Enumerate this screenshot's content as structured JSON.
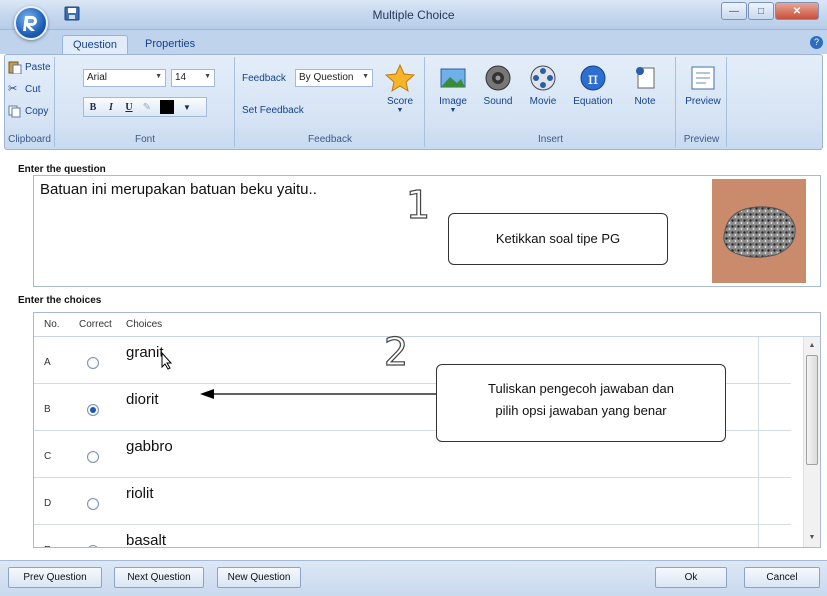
{
  "window": {
    "title": "Multiple Choice"
  },
  "tabs": [
    {
      "label": "Question"
    },
    {
      "label": "Properties"
    }
  ],
  "ribbon": {
    "clipboard": {
      "paste": "Paste",
      "cut": "Cut",
      "copy": "Copy",
      "label": "Clipboard"
    },
    "font": {
      "family": "Arial",
      "size": "14",
      "bold": "B",
      "italic": "I",
      "underline": "U",
      "label": "Font"
    },
    "feedback": {
      "feedback_label": "Feedback",
      "feedback_value": "By Question",
      "set_feedback": "Set Feedback",
      "score": "Score",
      "label": "Feedback"
    },
    "insert": {
      "image": "Image",
      "sound": "Sound",
      "movie": "Movie",
      "equation": "Equation",
      "note": "Note",
      "label": "Insert"
    },
    "preview": {
      "preview": "Preview",
      "label": "Preview"
    }
  },
  "question": {
    "label": "Enter the question",
    "text": "Batuan ini merupakan batuan beku yaitu.."
  },
  "choices": {
    "label": "Enter the choices",
    "headers": {
      "no": "No.",
      "correct": "Correct",
      "choices": "Choices"
    },
    "rows": [
      {
        "no": "A",
        "text": "granit",
        "correct": false
      },
      {
        "no": "B",
        "text": "diorit",
        "correct": true
      },
      {
        "no": "C",
        "text": "gabbro",
        "correct": false
      },
      {
        "no": "D",
        "text": "riolit",
        "correct": false
      },
      {
        "no": "E",
        "text": "basalt",
        "correct": false
      }
    ]
  },
  "annotations": {
    "num1": "1",
    "num2": "2",
    "callout1": "Ketikkan soal tipe PG",
    "callout2_line1": "Tuliskan pengecoh jawaban dan",
    "callout2_line2": "pilih opsi jawaban yang benar"
  },
  "buttons": {
    "prev": "Prev Question",
    "next": "Next Question",
    "new": "New Question",
    "ok": "Ok",
    "cancel": "Cancel"
  },
  "colors": {
    "accent": "#15428b",
    "ribbon": "#d5e3f4",
    "selected_radio": "#1d55b3"
  }
}
